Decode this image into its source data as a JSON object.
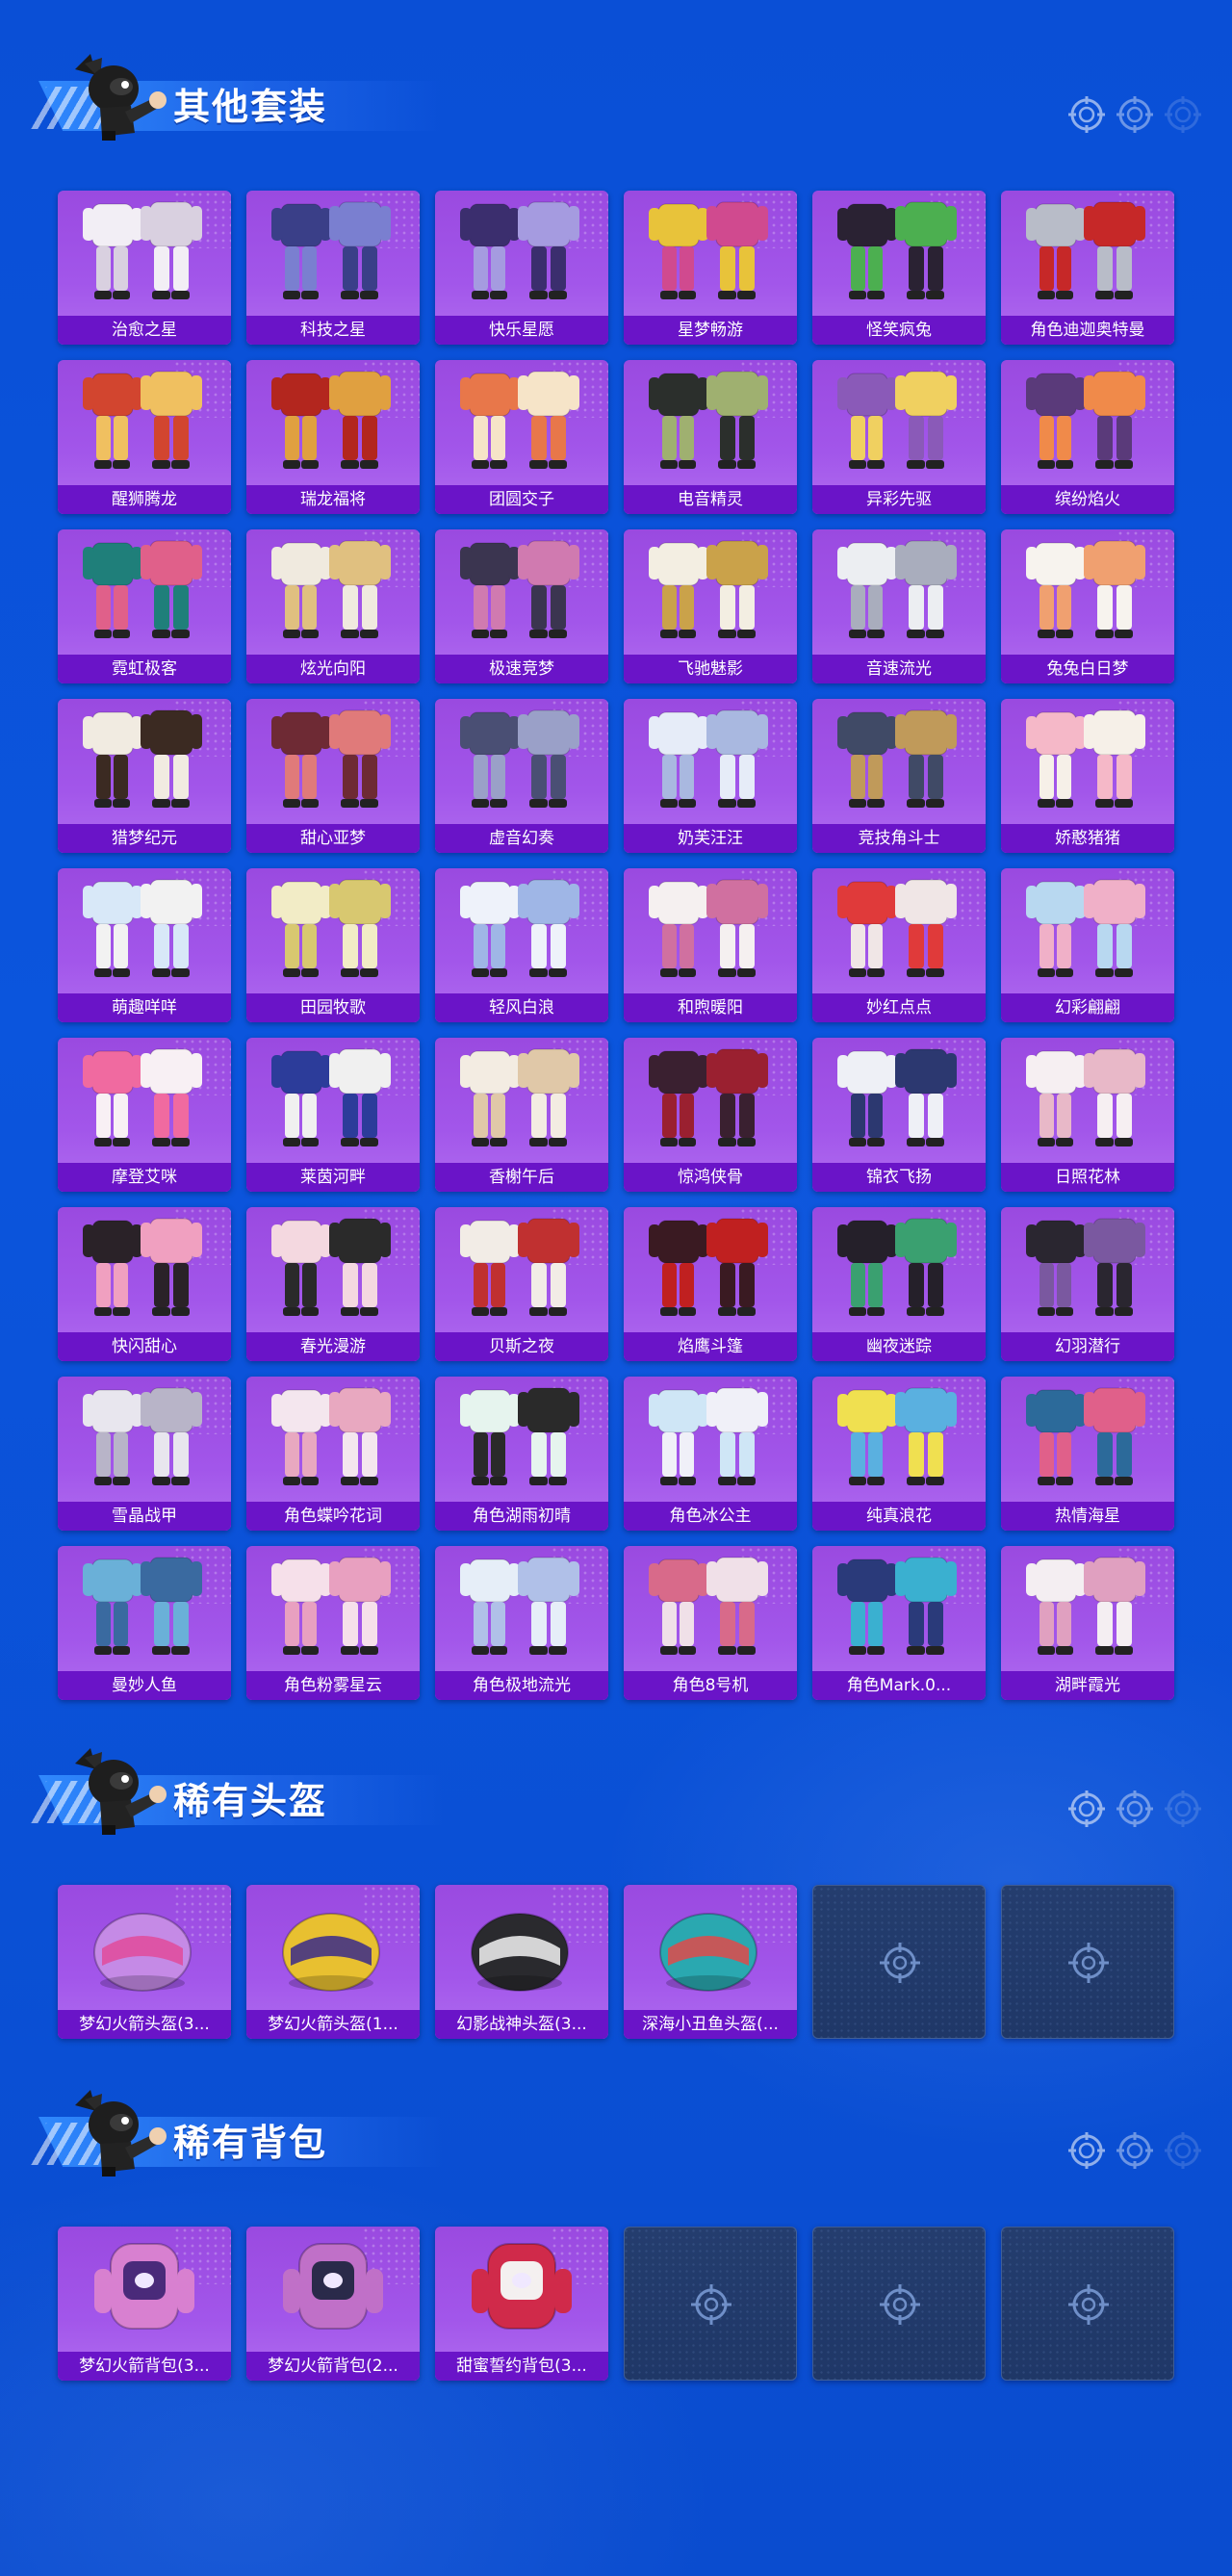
{
  "sections": [
    {
      "title": "其他套装",
      "items": [
        {
          "label": "治愈之星",
          "color": "#f2eef5",
          "accent": "#d9d0e0"
        },
        {
          "label": "科技之星",
          "color": "#3a3f88",
          "accent": "#7a7fd0"
        },
        {
          "label": "快乐星愿",
          "color": "#3b2e6e",
          "accent": "#a59be0"
        },
        {
          "label": "星梦畅游",
          "color": "#e8c33a",
          "accent": "#d04a8f"
        },
        {
          "label": "怪笑疯兔",
          "color": "#2a2233",
          "accent": "#4caf50"
        },
        {
          "label": "角色迪迦奥特曼",
          "color": "#b8bcc8",
          "accent": "#c62828"
        },
        {
          "label": "醒狮腾龙",
          "color": "#d2452f",
          "accent": "#f0c060"
        },
        {
          "label": "瑞龙福将",
          "color": "#b3261e",
          "accent": "#e0a040"
        },
        {
          "label": "团圆交子",
          "color": "#e8774a",
          "accent": "#f6e4c8"
        },
        {
          "label": "电音精灵",
          "color": "#2b2f2c",
          "accent": "#9fb070"
        },
        {
          "label": "异彩先驱",
          "color": "#8a5ab8",
          "accent": "#f0d060"
        },
        {
          "label": "缤纷焰火",
          "color": "#5a3a7a",
          "accent": "#f08a4a"
        },
        {
          "label": "霓虹极客",
          "color": "#1f7f7a",
          "accent": "#e0608a"
        },
        {
          "label": "炫光向阳",
          "color": "#f0eadf",
          "accent": "#e0c080"
        },
        {
          "label": "极速竞梦",
          "color": "#3b3550",
          "accent": "#d07ab0"
        },
        {
          "label": "飞驰魅影",
          "color": "#f3eee2",
          "accent": "#caa24a"
        },
        {
          "label": "音速流光",
          "color": "#eceef2",
          "accent": "#a9adbd"
        },
        {
          "label": "兔兔白日梦",
          "color": "#f7f3ee",
          "accent": "#f0a070"
        },
        {
          "label": "猎梦纪元",
          "color": "#f1ebe1",
          "accent": "#3b2a22"
        },
        {
          "label": "甜心亚梦",
          "color": "#6e2a34",
          "accent": "#e07a7a"
        },
        {
          "label": "虚音幻奏",
          "color": "#4a4f74",
          "accent": "#9aa0c8"
        },
        {
          "label": "奶芙汪汪",
          "color": "#e6ecf8",
          "accent": "#a9b8e0"
        },
        {
          "label": "竞技角斗士",
          "color": "#404a66",
          "accent": "#c09a5a"
        },
        {
          "label": "娇憨猪猪",
          "color": "#f5b8c8",
          "accent": "#f6f0e8"
        },
        {
          "label": "萌趣咩咩",
          "color": "#d8e8f8",
          "accent": "#f2f2f2"
        },
        {
          "label": "田园牧歌",
          "color": "#f2ecc6",
          "accent": "#d8c870"
        },
        {
          "label": "轻风白浪",
          "color": "#eef2fa",
          "accent": "#9fb6e6"
        },
        {
          "label": "和煦暖阳",
          "color": "#f5f0f0",
          "accent": "#d070a0"
        },
        {
          "label": "妙红点点",
          "color": "#e03a3a",
          "accent": "#f0e6e6"
        },
        {
          "label": "幻彩翩翩",
          "color": "#b8d8f0",
          "accent": "#f0b0c8"
        },
        {
          "label": "摩登艾咪",
          "color": "#f06aa0",
          "accent": "#f8f0f4"
        },
        {
          "label": "莱茵河畔",
          "color": "#2c3c9a",
          "accent": "#f0f0f0"
        },
        {
          "label": "香榭午后",
          "color": "#f3ece2",
          "accent": "#e0c8a8"
        },
        {
          "label": "惊鸿侠骨",
          "color": "#3a2030",
          "accent": "#9a2030"
        },
        {
          "label": "锦衣飞扬",
          "color": "#eef0f6",
          "accent": "#2c3870"
        },
        {
          "label": "日照花林",
          "color": "#f6eff2",
          "accent": "#e8b8c8"
        },
        {
          "label": "快闪甜心",
          "color": "#2a2228",
          "accent": "#f0a0c0"
        },
        {
          "label": "春光漫游",
          "color": "#f4d8e0",
          "accent": "#2a2a2a"
        },
        {
          "label": "贝斯之夜",
          "color": "#f2ece6",
          "accent": "#c03030"
        },
        {
          "label": "焰鹰斗篷",
          "color": "#3a1a22",
          "accent": "#c02020"
        },
        {
          "label": "幽夜迷踪",
          "color": "#25202a",
          "accent": "#3aa070"
        },
        {
          "label": "幻羽潜行",
          "color": "#2a2630",
          "accent": "#7a58a0"
        },
        {
          "label": "雪晶战甲",
          "color": "#e8e6ee",
          "accent": "#b8b4c8"
        },
        {
          "label": "角色蝶吟花词",
          "color": "#f4e6ee",
          "accent": "#e8a8c0"
        },
        {
          "label": "角色湖雨初晴",
          "color": "#e6f4ee",
          "accent": "#2a2a2a"
        },
        {
          "label": "角色冰公主",
          "color": "#cfe6f6",
          "accent": "#f0f0f8"
        },
        {
          "label": "纯真浪花",
          "color": "#f0e050",
          "accent": "#5ab0e0"
        },
        {
          "label": "热情海星",
          "color": "#2c6a9a",
          "accent": "#e0608a"
        },
        {
          "label": "曼妙人鱼",
          "color": "#6ab0d8",
          "accent": "#3a6aa0"
        },
        {
          "label": "角色粉雾星云",
          "color": "#f6e0ea",
          "accent": "#e8a0c0"
        },
        {
          "label": "角色极地流光",
          "color": "#e6eef8",
          "accent": "#b0c0e8"
        },
        {
          "label": "角色8号机",
          "color": "#d86a8a",
          "accent": "#f0e0e8"
        },
        {
          "label": "角色Mark.0...",
          "color": "#2a3a7a",
          "accent": "#3ab0d0"
        },
        {
          "label": "湖畔霞光",
          "color": "#f4eef2",
          "accent": "#e0a0c0"
        }
      ]
    },
    {
      "title": "稀有头盔",
      "items": [
        {
          "label": "梦幻火箭头盔(3...",
          "color": "#c58ae6",
          "accent": "#e04a9a"
        },
        {
          "label": "梦幻火箭头盔(1...",
          "color": "#e8c030",
          "accent": "#3a2a8a"
        },
        {
          "label": "幻影战神头盔(3...",
          "color": "#2a2a2e",
          "accent": "#f2f2f2"
        },
        {
          "label": "深海小丑鱼头盔(...",
          "color": "#2aa8b0",
          "accent": "#e04a4a"
        },
        {
          "label": "",
          "empty": true
        },
        {
          "label": "",
          "empty": true
        }
      ]
    },
    {
      "title": "稀有背包",
      "items": [
        {
          "label": "梦幻火箭背包(3...",
          "color": "#d880d0",
          "accent": "#4a2a7a"
        },
        {
          "label": "梦幻火箭背包(2...",
          "color": "#c070c8",
          "accent": "#2a2a4a"
        },
        {
          "label": "甜蜜誓约背包(3...",
          "color": "#d02a4a",
          "accent": "#f4f0f0"
        },
        {
          "label": "",
          "empty": true
        },
        {
          "label": "",
          "empty": true
        },
        {
          "label": "",
          "empty": true
        }
      ]
    }
  ],
  "icons": {
    "target": "target-crosshair-icon",
    "slot": "empty-slot-crosshair-icon",
    "mascot": "mascot-icon"
  }
}
